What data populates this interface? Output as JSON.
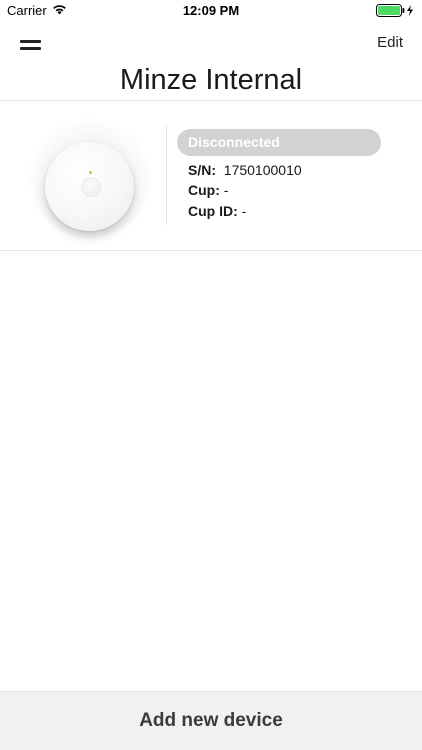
{
  "status_bar": {
    "carrier": "Carrier",
    "time": "12:09 PM",
    "battery_color": "#4cd964",
    "icons": [
      "wifi-icon",
      "battery-icon",
      "charging-bolt-icon"
    ]
  },
  "nav": {
    "menu_icon": "hamburger-menu-icon",
    "edit_label": "Edit",
    "title": "Minze Internal"
  },
  "devices": [
    {
      "status": "Disconnected",
      "status_color": "#d2d2d2",
      "sn_label": "S/N:",
      "sn_value": "1750100010",
      "cup_label": "Cup:",
      "cup_value": "-",
      "cup_id_label": "Cup ID:",
      "cup_id_value": "-",
      "led_color": "#8ee04a"
    }
  ],
  "footer": {
    "add_device_label": "Add new device"
  }
}
